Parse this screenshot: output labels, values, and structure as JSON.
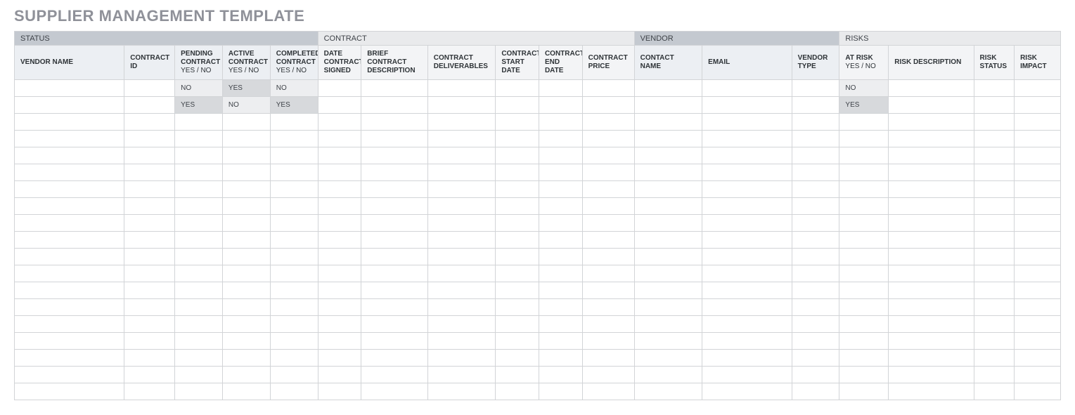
{
  "title": "SUPPLIER MANAGEMENT TEMPLATE",
  "yes_no_sub": "YES / NO",
  "groups": {
    "status": "STATUS",
    "contract": "CONTRACT",
    "vendor": "VENDOR",
    "risks": "RISKS"
  },
  "columns": {
    "vendor_name": "VENDOR NAME",
    "contract_id": "CONTRACT ID",
    "pending_contract": "PENDING CONTRACT",
    "active_contract": "ACTIVE CONTRACT",
    "completed_contract": "COMPLETED CONTRACT",
    "date_contract_signed": "DATE CONTRACT SIGNED",
    "brief_contract_description": "BRIEF CONTRACT DESCRIPTION",
    "contract_deliverables": "CONTRACT DELIVERABLES",
    "contract_start_date": "CONTRACT START DATE",
    "contract_end_date": "CONTRACT END DATE",
    "contract_price": "CONTRACT PRICE",
    "contact_name": "CONTACT NAME",
    "email": "EMAIL",
    "vendor_type": "VENDOR TYPE",
    "at_risk": "AT RISK",
    "risk_description": "RISK DESCRIPTION",
    "risk_status": "RISK STATUS",
    "risk_impact": "RISK IMPACT"
  },
  "rows": [
    {
      "vendor_name": "",
      "contract_id": "",
      "pending_contract": "NO",
      "active_contract": "YES",
      "completed_contract": "NO",
      "date_contract_signed": "",
      "brief_contract_description": "",
      "contract_deliverables": "",
      "contract_start_date": "",
      "contract_end_date": "",
      "contract_price": "",
      "contact_name": "",
      "email": "",
      "vendor_type": "",
      "at_risk": "NO",
      "risk_description": "",
      "risk_status": "",
      "risk_impact": ""
    },
    {
      "vendor_name": "",
      "contract_id": "",
      "pending_contract": "YES",
      "active_contract": "NO",
      "completed_contract": "YES",
      "date_contract_signed": "",
      "brief_contract_description": "",
      "contract_deliverables": "",
      "contract_start_date": "",
      "contract_end_date": "",
      "contract_price": "",
      "contact_name": "",
      "email": "",
      "vendor_type": "",
      "at_risk": "YES",
      "risk_description": "",
      "risk_status": "",
      "risk_impact": ""
    }
  ],
  "empty_row_count": 17
}
